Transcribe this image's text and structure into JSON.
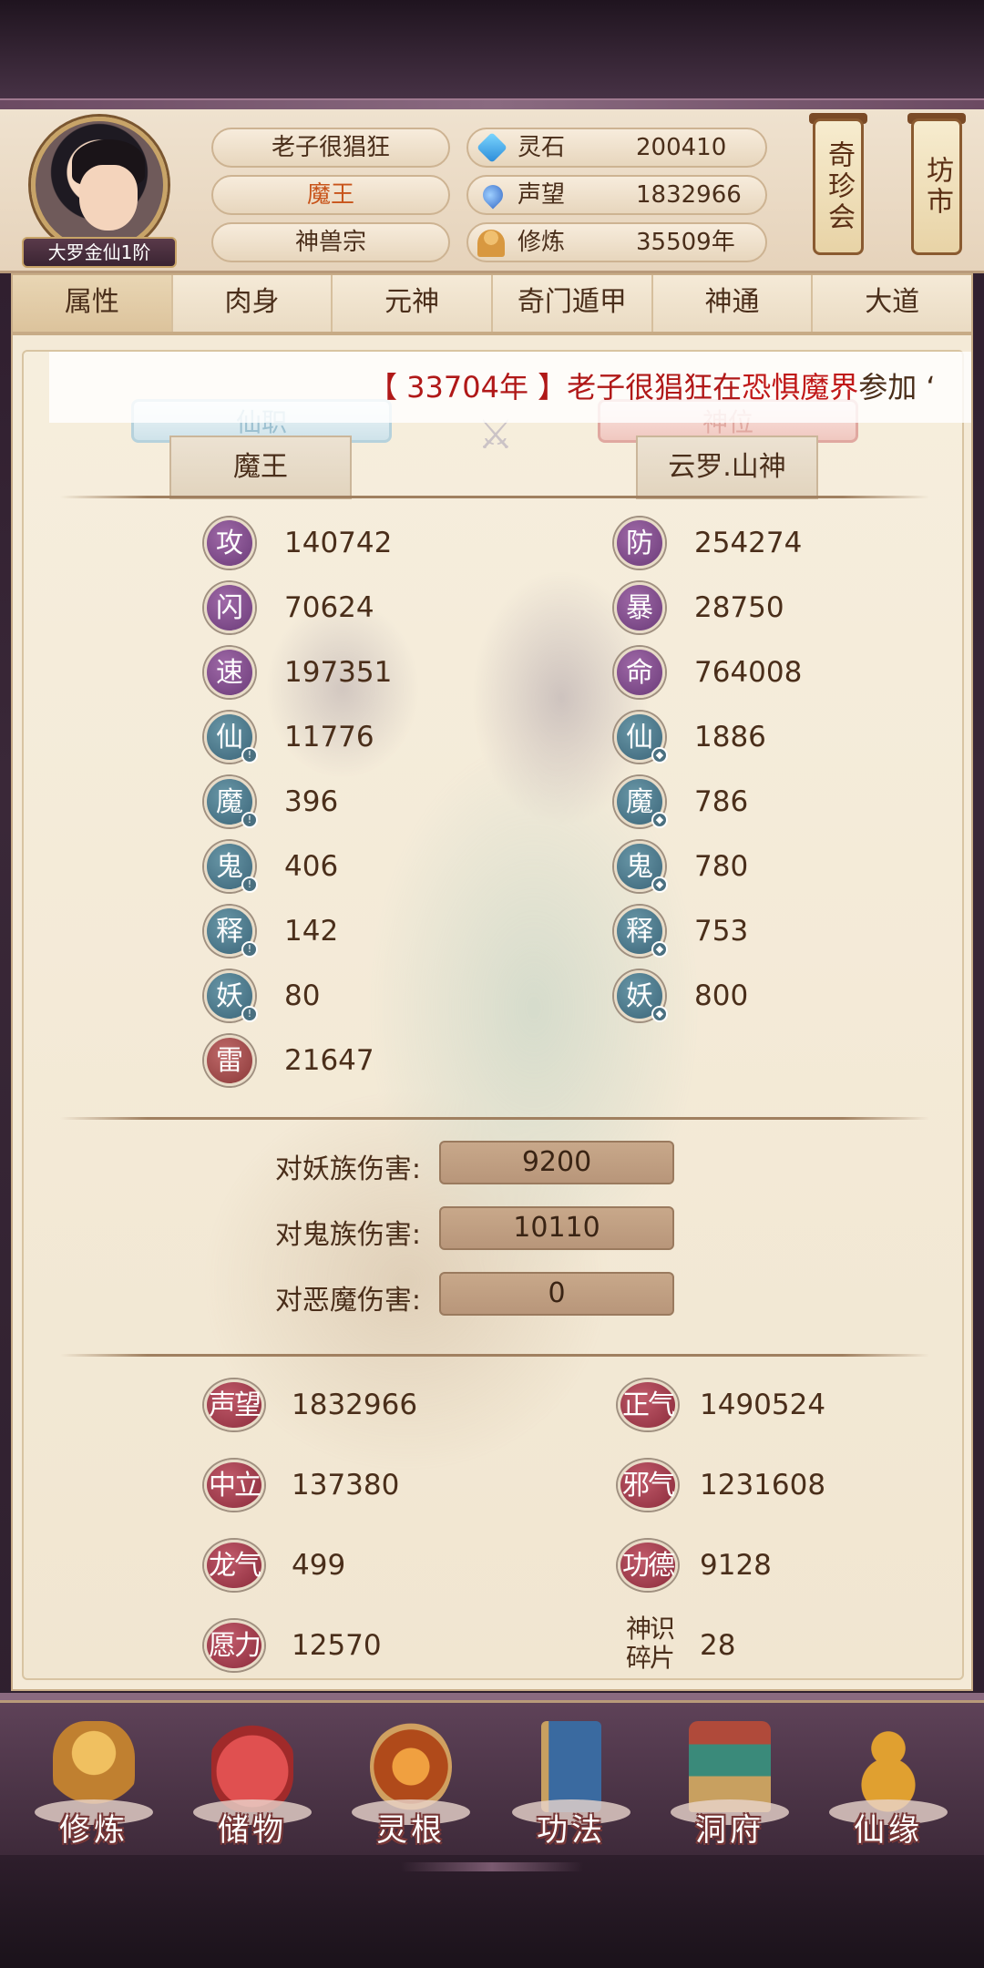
{
  "player": {
    "name": "老子很猖狂",
    "title": "魔王",
    "sect": "神兽宗",
    "rank": "大罗金仙1阶"
  },
  "resources": [
    {
      "icon": "spirit-stone-icon",
      "label": "灵石",
      "value": "200410"
    },
    {
      "icon": "reputation-icon",
      "label": "声望",
      "value": "1832966"
    },
    {
      "icon": "cultivation-icon",
      "label": "修炼",
      "value": "35509年"
    }
  ],
  "banners": {
    "market_treasure": "奇珍会",
    "market": "坊市"
  },
  "tabs": [
    "属性",
    "肉身",
    "元神",
    "奇门遁甲",
    "神通",
    "大道"
  ],
  "ticker": {
    "year": "【 33704年 】",
    "name": "老子很猖狂",
    "mid": "在",
    "place": "恐惧魔界",
    "tail": "参加 ‘"
  },
  "positions": {
    "immortal_post_label": "仙职",
    "immortal_post_value": "魔王",
    "divine_rank_label": "神位",
    "divine_rank_value": "云罗.山神"
  },
  "stats_left": [
    {
      "char": "攻",
      "value": "140742"
    },
    {
      "char": "闪",
      "value": "70624"
    },
    {
      "char": "速",
      "value": "197351"
    },
    {
      "char": "仙",
      "value": "11776"
    },
    {
      "char": "魔",
      "value": "396"
    },
    {
      "char": "鬼",
      "value": "406"
    },
    {
      "char": "释",
      "value": "142"
    },
    {
      "char": "妖",
      "value": "80"
    },
    {
      "char": "雷",
      "value": "21647"
    }
  ],
  "stats_right": [
    {
      "char": "防",
      "value": "254274"
    },
    {
      "char": "暴",
      "value": "28750"
    },
    {
      "char": "命",
      "value": "764008"
    },
    {
      "char": "仙",
      "value": "1886"
    },
    {
      "char": "魔",
      "value": "786"
    },
    {
      "char": "鬼",
      "value": "780"
    },
    {
      "char": "释",
      "value": "753"
    },
    {
      "char": "妖",
      "value": "800"
    }
  ],
  "damage": [
    {
      "label": "对妖族伤害:",
      "value": "9200"
    },
    {
      "label": "对鬼族伤害:",
      "value": "10110"
    },
    {
      "label": "对恶魔伤害:",
      "value": "0"
    }
  ],
  "reputation": {
    "left": [
      {
        "label": "声望",
        "value": "1832966"
      },
      {
        "label": "中立",
        "value": "137380"
      },
      {
        "label": "龙气",
        "value": "499"
      },
      {
        "label": "愿力",
        "value": "12570"
      }
    ],
    "right": [
      {
        "label": "正气",
        "value": "1490524"
      },
      {
        "label": "邪气",
        "value": "1231608"
      },
      {
        "label": "功德",
        "value": "9128"
      },
      {
        "label": "神识碎片",
        "value": "28"
      }
    ]
  },
  "bottom_nav": [
    {
      "label": "修炼",
      "icon": "cultivation-monk-icon",
      "color": "#e0a040"
    },
    {
      "label": "储物",
      "icon": "storage-bag-icon",
      "color": "#d04a4a"
    },
    {
      "label": "灵根",
      "icon": "spirit-root-icon",
      "color": "#b04a2a"
    },
    {
      "label": "功法",
      "icon": "technique-book-icon",
      "color": "#3a6aa0"
    },
    {
      "label": "洞府",
      "icon": "cave-mansion-icon",
      "color": "#a07040"
    },
    {
      "label": "仙缘",
      "icon": "fortune-gourd-icon",
      "color": "#d09030"
    }
  ]
}
